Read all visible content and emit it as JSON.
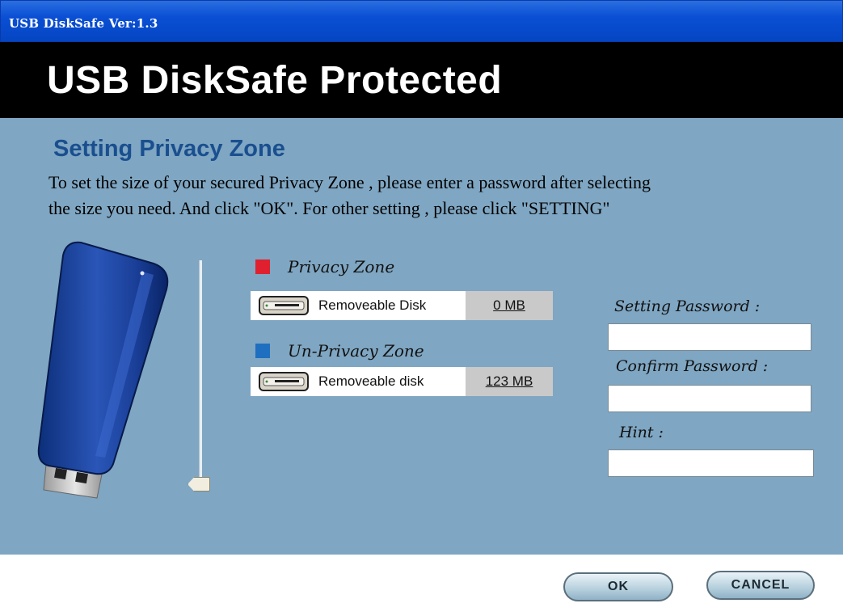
{
  "window": {
    "title": "USB DiskSafe Ver:1.3"
  },
  "banner": {
    "title": "USB DiskSafe Protected"
  },
  "main": {
    "section_title": "Setting Privacy Zone",
    "instructions_line1": "To set the size of your secured Privacy Zone , please enter a password after selecting",
    "instructions_line2": "the size you need. And click \"OK\". For other setting , please click \"SETTING\""
  },
  "zones": {
    "privacy": {
      "label": "Privacy Zone",
      "color": "#e0202e",
      "disk_name": "Removeable Disk",
      "size": "0 MB"
    },
    "unprivacy": {
      "label": "Un-Privacy Zone",
      "color": "#1f6fc0",
      "disk_name": "Removeable disk",
      "size": "123 MB"
    }
  },
  "slider": {
    "privacy_fraction": 0
  },
  "form": {
    "setting_password_label": "Setting Password :",
    "setting_password_value": "",
    "confirm_password_label": "Confirm Password :",
    "confirm_password_value": "",
    "hint_label": "Hint :",
    "hint_value": ""
  },
  "buttons": {
    "ok": "OK",
    "cancel": "CANCEL"
  },
  "icons": {
    "usb_drive": "usb-drive-icon",
    "disk": "removable-disk-icon"
  }
}
